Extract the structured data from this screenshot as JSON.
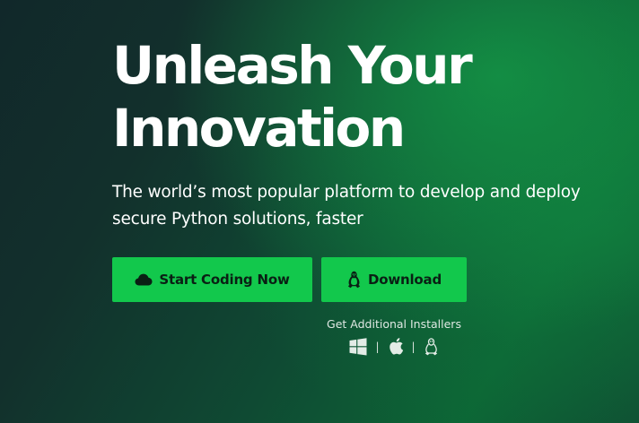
{
  "hero": {
    "headline_line1": "Unleash Your",
    "headline_line2": "Innovation",
    "subtitle": "The world’s most popular platform to develop and deploy secure Python solutions, faster"
  },
  "buttons": {
    "start_coding": {
      "label": "Start Coding Now",
      "icon": "cloud-icon"
    },
    "download": {
      "label": "Download",
      "icon": "linux-tux-icon"
    }
  },
  "installers": {
    "label": "Get Additional Installers",
    "icons": [
      "windows-icon",
      "apple-icon",
      "linux-tux-icon"
    ],
    "separator": "|"
  },
  "colors": {
    "button_bg": "#12c84c",
    "button_text": "#0a1f14",
    "headline": "#ffffff",
    "background_dark": "#11282a",
    "background_green": "#0c6535"
  }
}
